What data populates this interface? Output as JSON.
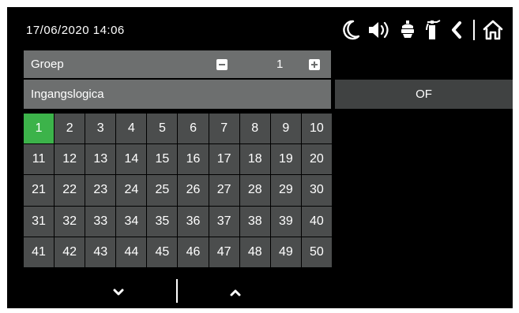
{
  "status_bar": {
    "datetime": "17/06/2020  14:06",
    "icons": [
      "moon-icon",
      "speaker-icon",
      "fire-alarm-icon",
      "extinguisher-icon",
      "back-icon",
      "home-icon"
    ]
  },
  "groep": {
    "label": "Groep",
    "value": "1",
    "minus_icon": "minus-icon",
    "plus_icon": "plus-icon"
  },
  "ingangslogica": {
    "label": "Ingangslogica",
    "option": "OF"
  },
  "grid": {
    "numbers": [
      "1",
      "2",
      "3",
      "4",
      "5",
      "6",
      "7",
      "8",
      "9",
      "10",
      "11",
      "12",
      "13",
      "14",
      "15",
      "16",
      "17",
      "18",
      "19",
      "20",
      "21",
      "22",
      "23",
      "24",
      "25",
      "26",
      "27",
      "28",
      "29",
      "30",
      "31",
      "32",
      "33",
      "34",
      "35",
      "36",
      "37",
      "38",
      "39",
      "40",
      "41",
      "42",
      "43",
      "44",
      "45",
      "46",
      "47",
      "48",
      "49",
      "50"
    ],
    "selected": "1"
  },
  "colors": {
    "background": "#000000",
    "panel": "#6d6f6f",
    "cell": "#4b4d4d",
    "option": "#404242",
    "selected": "#3cb34a",
    "text": "#ffffff"
  },
  "nav": {
    "down_icon": "chevron-down-icon",
    "up_icon": "chevron-up-icon"
  }
}
